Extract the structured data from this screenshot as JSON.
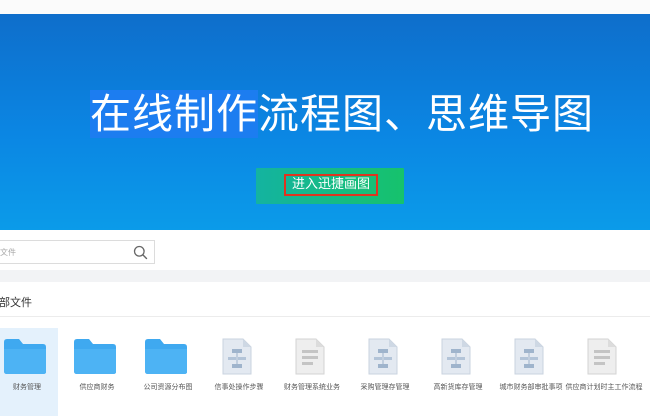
{
  "hero": {
    "title_selected": "在线制作",
    "title_rest": "流程图、思维导图",
    "cta_label": "进入迅捷画图"
  },
  "search": {
    "placeholder": "文件"
  },
  "section": {
    "title": "部文件"
  },
  "files": [
    {
      "name": "财务管理",
      "kind": "folder",
      "selected": true
    },
    {
      "name": "供应商财务",
      "kind": "folder"
    },
    {
      "name": "公司资源分布图",
      "kind": "folder"
    },
    {
      "name": "信事处操作步骤",
      "kind": "flow-doc"
    },
    {
      "name": "财务管理系统业务",
      "kind": "form-doc"
    },
    {
      "name": "采购管理存管理",
      "kind": "flow-doc"
    },
    {
      "name": "高新货库存管理",
      "kind": "flow-doc"
    },
    {
      "name": "城市财务部审批事项",
      "kind": "flow-doc"
    },
    {
      "name": "供应商计划时主工作流程",
      "kind": "form-doc"
    }
  ],
  "colors": {
    "hero_top": "#0e6ecb",
    "hero_bottom": "#0b9be9",
    "cta_start": "#14b3a0",
    "cta_end": "#16c26c",
    "highlight_border": "#e0341f",
    "folder": "#3fa9f0"
  }
}
